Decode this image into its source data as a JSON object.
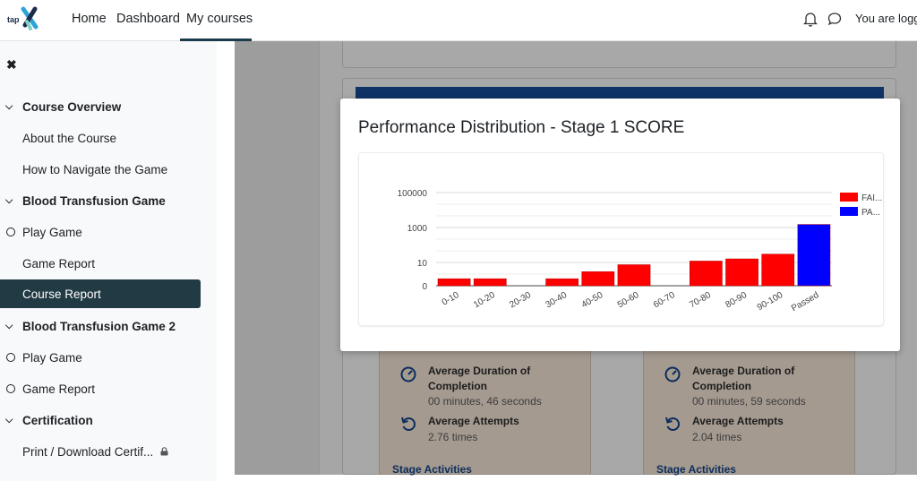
{
  "nav": {
    "logo_text": "tap",
    "links": [
      "Home",
      "Dashboard",
      "My courses"
    ],
    "active": "My courses",
    "user_text": "You are logge"
  },
  "sidebar": {
    "close_icon": "close-icon",
    "items": [
      {
        "type": "section",
        "label": "Course Overview"
      },
      {
        "type": "link",
        "label": "About the Course"
      },
      {
        "type": "link",
        "label": "How to Navigate the Game"
      },
      {
        "type": "section",
        "label": "Blood Transfusion Game"
      },
      {
        "type": "activity",
        "label": "Play Game"
      },
      {
        "type": "link",
        "label": "Game Report"
      },
      {
        "type": "link",
        "label": "Course Report",
        "active": true
      },
      {
        "type": "section",
        "label": "Blood Transfusion Game 2"
      },
      {
        "type": "activity",
        "label": "Play Game"
      },
      {
        "type": "activity",
        "label": "Game Report"
      },
      {
        "type": "section",
        "label": "Certification"
      },
      {
        "type": "link",
        "label": "Print / Download Certif...",
        "locked": true
      }
    ]
  },
  "stats": [
    {
      "duration_title": "Average Duration of Completion",
      "duration_value": "00 minutes, 46 seconds",
      "attempts_title": "Average Attempts",
      "attempts_value": "2.76 times",
      "link": "Stage Activities"
    },
    {
      "duration_title": "Average Duration of Completion",
      "duration_value": "00 minutes, 59 seconds",
      "attempts_title": "Average Attempts",
      "attempts_value": "2.04 times",
      "link": "Stage Activities"
    }
  ],
  "modal": {
    "title": "Performance Distribution - Stage 1 SCORE"
  },
  "colors": {
    "failed": "#ff0000",
    "passed": "#0000ff",
    "sidebar_active": "#213a43",
    "header_blue": "#0f3366"
  },
  "chart_data": {
    "type": "bar",
    "yscale": "log",
    "categories": [
      "0-10",
      "10-20",
      "20-30",
      "30-40",
      "40-50",
      "50-60",
      "60-70",
      "70-80",
      "80-90",
      "90-100",
      "Passed"
    ],
    "yticks": [
      "0",
      "10",
      "1000",
      "100000"
    ],
    "series": [
      {
        "name": "FAI...",
        "color": "#ff0000",
        "values": [
          2,
          2,
          0,
          2,
          4,
          8,
          0,
          12,
          16,
          30,
          0
        ]
      },
      {
        "name": "PA...",
        "color": "#0000ff",
        "values": [
          0,
          0,
          0,
          0,
          0,
          0,
          0,
          0,
          0,
          0,
          1500
        ]
      }
    ],
    "legend": "right",
    "grid": true
  }
}
